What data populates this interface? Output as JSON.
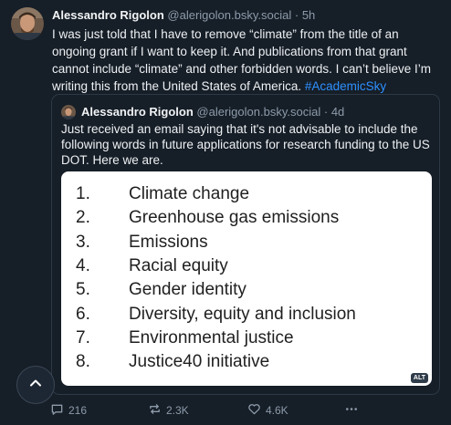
{
  "post": {
    "author_name": "Alessandro Rigolon",
    "author_handle": "@alerigolon.bsky.social",
    "separator": "·",
    "time": "5h",
    "text": "I was just told that I have to remove “climate” from the title of an ongoing grant if I want to keep it. And publications from that grant cannot include “climate” and other forbidden words. I can’t believe I’m writing this from the United States of America.",
    "hashtag": "#AcademicSky"
  },
  "quote": {
    "author_name": "Alessandro Rigolon",
    "author_handle": "@alerigolon.bsky.social",
    "separator": "·",
    "time": "4d",
    "text": "Just received an email saying that it's not advisable to include the following words in future applications for research funding to the US DOT. Here we are.",
    "image_list": [
      {
        "num": "1.",
        "text": "Climate change"
      },
      {
        "num": "2.",
        "text": "Greenhouse gas emissions"
      },
      {
        "num": "3.",
        "text": "Emissions"
      },
      {
        "num": "4.",
        "text": "Racial equity"
      },
      {
        "num": "5.",
        "text": "Gender identity"
      },
      {
        "num": "6.",
        "text": "Diversity, equity and inclusion"
      },
      {
        "num": "7.",
        "text": "Environmental justice"
      },
      {
        "num": "8.",
        "text": "Justice40 initiative"
      }
    ],
    "alt_badge": "ALT"
  },
  "actions": {
    "replies": "216",
    "reposts": "2.3K",
    "likes": "4.6K"
  },
  "icons": {
    "reply": "speech-bubble-icon",
    "repost": "repost-arrows-icon",
    "like": "heart-icon",
    "more": "ellipsis-icon",
    "scroll": "chevron-up-icon"
  },
  "colors": {
    "background": "#161e27",
    "link": "#2e90ff",
    "muted": "#8d9bab"
  }
}
